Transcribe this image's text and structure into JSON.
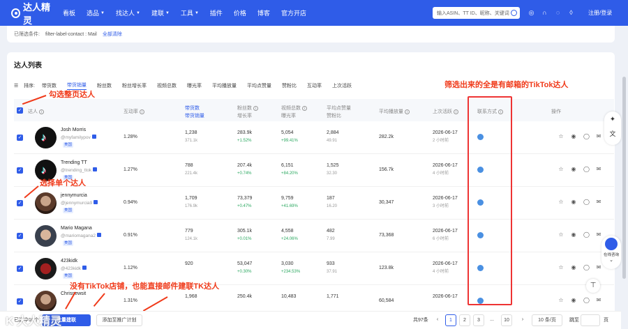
{
  "header": {
    "logo": "达人精灵",
    "nav": [
      {
        "label": "看板",
        "caret": false
      },
      {
        "label": "选品",
        "caret": true
      },
      {
        "label": "找达人",
        "caret": true
      },
      {
        "label": "建联",
        "caret": true
      },
      {
        "label": "工具",
        "caret": true
      },
      {
        "label": "插件",
        "caret": false
      },
      {
        "label": "价格",
        "caret": false
      },
      {
        "label": "博客",
        "caret": false
      },
      {
        "label": "官方开店",
        "caret": false
      }
    ],
    "search_placeholder": "输入ASIN、TT ID、昵称、关键词",
    "login": "注册/登录"
  },
  "filter": {
    "label": "已筛选条件:",
    "chip": "filter-label-contact : Mail",
    "clear": "全部清除"
  },
  "list": {
    "title": "达人列表",
    "sort_label": "排序:",
    "sort_items": [
      "带货数",
      "带货销量",
      "粉丝数",
      "粉丝增长率",
      "视频总数",
      "曝光率",
      "平均播放量",
      "平均点赞量",
      "赞粉比",
      "互动率",
      "上次活跃"
    ],
    "active_sort": 1
  },
  "columns": {
    "influencer": "达人",
    "engagement": "互动率",
    "sales1": "带货数",
    "sales2": "带货销量",
    "fans1": "粉丝数",
    "fans2": "增长率",
    "videos1": "视频总数",
    "videos2": "曝光率",
    "likes1": "平均点赞量",
    "likes2": "赞粉比",
    "avg_play": "平均播放量",
    "last_active": "上次活跃",
    "contact": "联系方式",
    "ops": "操作"
  },
  "rows": [
    {
      "name": "Josh Morris",
      "handle": "@myfamilypov",
      "tag": "美国",
      "engagement": "1.28%",
      "sales": "1,238",
      "sales_sub": "371.1k",
      "fans": "283.9k",
      "fans_growth": "+1.52%",
      "videos": "5,054",
      "videos_growth": "+99.41%",
      "likes": "2,884",
      "likes_sub": "49.91",
      "avg_play": "282.2k",
      "date": "2026-06-17",
      "ago": "2 小时前",
      "avatar": "tiktok"
    },
    {
      "name": "Trending TT",
      "handle": "@trending_ttok",
      "tag": "美国",
      "engagement": "1.27%",
      "sales": "788",
      "sales_sub": "221.4k",
      "fans": "207.4k",
      "fans_growth": "+0.74%",
      "videos": "6,151",
      "videos_growth": "+84.20%",
      "likes": "1,525",
      "likes_sub": "32.30",
      "avg_play": "156.7k",
      "date": "2026-06-17",
      "ago": "4 小时前",
      "avatar": "tiktok"
    },
    {
      "name": "jennymurcia",
      "handle": "@jennymurcia9",
      "tag": "美国",
      "engagement": "0.94%",
      "sales": "1,709",
      "sales_sub": "176.9k",
      "fans": "73,379",
      "fans_growth": "+0.47%",
      "videos": "9,759",
      "videos_growth": "+41.69%",
      "likes": "187",
      "likes_sub": "16.20",
      "avg_play": "30,347",
      "date": "2026-06-17",
      "ago": "3 小时前",
      "avatar": "photo"
    },
    {
      "name": "Mario Magana",
      "handle": "@mariomagana2",
      "tag": "美国",
      "engagement": "0.91%",
      "sales": "779",
      "sales_sub": "124.1k",
      "fans": "305.1k",
      "fans_growth": "+0.01%",
      "videos": "4,558",
      "videos_growth": "+24.06%",
      "likes": "482",
      "likes_sub": "7.99",
      "avg_play": "73,368",
      "date": "2026-06-17",
      "ago": "6 小时前",
      "avatar": "photo2"
    },
    {
      "name": "423kidk",
      "handle": "@423kidk",
      "tag": "美国",
      "engagement": "1.12%",
      "sales": "920",
      "sales_sub": "",
      "fans": "53,047",
      "fans_growth": "+0.30%",
      "videos": "3,030",
      "videos_growth": "+234.53%",
      "likes": "933",
      "likes_sub": "37.91",
      "avg_play": "123.8k",
      "date": "2026-06-17",
      "ago": "4 小时前",
      "avatar": "photo3"
    },
    {
      "name": "Chrisnewsit",
      "handle": "",
      "tag": "",
      "engagement": "1.31%",
      "sales": "1,968",
      "sales_sub": "",
      "fans": "250.4k",
      "fans_growth": "",
      "videos": "10,483",
      "videos_growth": "",
      "likes": "1,771",
      "likes_sub": "",
      "avg_play": "60,584",
      "date": "2026-06-17",
      "ago": "",
      "avatar": "photo"
    }
  ],
  "annotations": {
    "select_page": "勾选整页达人",
    "select_one": "选择单个达人",
    "filtered": "筛选出来的全是有邮箱的TikTok达人",
    "email": "没有TikTok店铺，也能直接邮件建联TK达人"
  },
  "footer": {
    "selected": "已选中10个",
    "btn1": "批量建联",
    "btn2": "添加至推广计划",
    "total": "共97条",
    "pages": [
      "1",
      "2",
      "3",
      "...",
      "10"
    ],
    "page_size": "10 条/页",
    "goto": "跳至",
    "page_unit": "页"
  },
  "float": {
    "chat": "在线咨询"
  },
  "watermark": "K 大人精灵"
}
